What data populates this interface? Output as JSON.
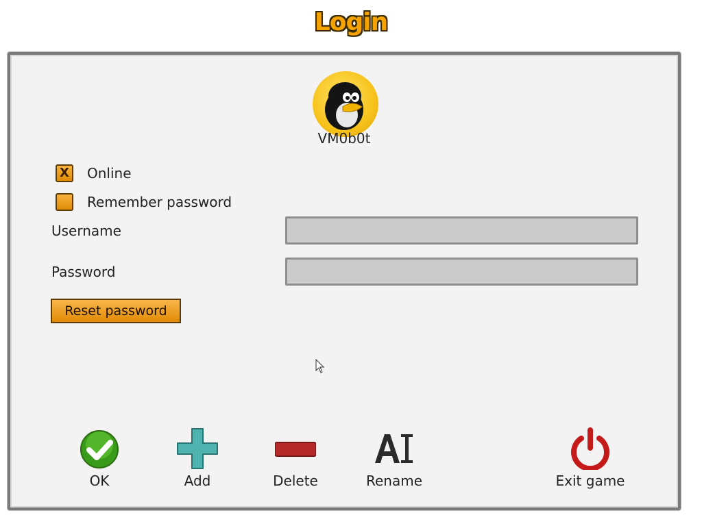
{
  "header": {
    "title": "Login"
  },
  "profile": {
    "name": "VM0b0t",
    "avatar_icon": "penguin-icon"
  },
  "options": {
    "online": {
      "label": "Online",
      "checked": true,
      "mark": "X"
    },
    "remember_password": {
      "label": "Remember password",
      "checked": false
    }
  },
  "form": {
    "username_label": "Username",
    "username_value": "",
    "password_label": "Password",
    "password_value": ""
  },
  "reset_button": {
    "label": "Reset password"
  },
  "actions": {
    "ok": {
      "label": "OK",
      "icon": "checkmark-icon"
    },
    "add": {
      "label": "Add",
      "icon": "plus-icon"
    },
    "delete": {
      "label": "Delete",
      "icon": "minus-icon"
    },
    "rename": {
      "label": "Rename",
      "icon": "rename-icon"
    },
    "exit": {
      "label": "Exit game",
      "icon": "power-icon"
    }
  },
  "colors": {
    "accent": "#f5a300",
    "ok_green": "#3a9a1a",
    "add_teal": "#4fb3b0",
    "delete_red": "#b42a2a",
    "exit_red": "#c41a1a",
    "input_bg": "#cbcbcb"
  }
}
